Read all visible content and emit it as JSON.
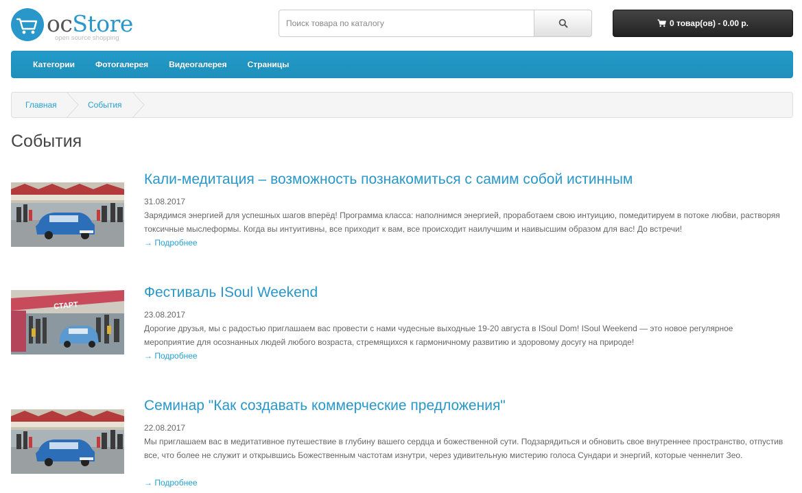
{
  "logo": {
    "oc": "oc",
    "store": "Store",
    "tagline": "open source shopping"
  },
  "search": {
    "placeholder": "Поиск товара по каталогу",
    "icon": "search-icon"
  },
  "cart": {
    "label": "0 товар(ов) - 0.00 р.",
    "icon": "cart-icon"
  },
  "menu": {
    "items": [
      {
        "label": "Категории"
      },
      {
        "label": "Фотогалерея"
      },
      {
        "label": "Видеогалерея"
      },
      {
        "label": "Страницы"
      }
    ]
  },
  "breadcrumb": {
    "items": [
      {
        "label": "Главная"
      },
      {
        "label": "События"
      }
    ]
  },
  "page_title": "События",
  "events": [
    {
      "title": "Кали-медитация – возможность познакомиться с самим собой истинным",
      "date": "31.08.2017",
      "text": "Зарядимся энергией для успешных шагов вперёд! Программа класса: наполнимся энергией, проработаем свою интуицию, помедитируем в потоке любви, растворяя токсичные мыслеформы. Когда вы интуитивны, все приходит к вам, все происходит наилучшим и наивысшим образом для вас! До встречи!",
      "more": "→ Подробнее"
    },
    {
      "title": "Фестиваль ISoul Weekend",
      "date": "23.08.2017",
      "text": "Дорогие друзья, мы с радостью приглашаем вас провести с нами чудесные выходные 19-20 августа в ISoul Dom! ISoul Weekend — это новое регулярное мероприятие для осознанных людей любого возраста, стремящихся к гармоничному развитию и здоровому досугу на природе!",
      "more": "→ Подробнее",
      "banner": "СТАРТ"
    },
    {
      "title": "Семинар \"Как создавать коммерческие предложения\"",
      "date": "22.08.2017",
      "text": "Мы приглашаем вас в медитативное путешествие в глубину вашего сердца и божественной сути. Подзарядиться и обновить свое внутреннее пространство, отпустив все, что более не служит и открывшись Божественным частотам изнутри, через удивительную мистерию голоса Сундари и энергий, которые ченнелит Зео.",
      "more": "→ Подробнее"
    }
  ],
  "colors": {
    "accent": "#2997c9",
    "menu": "#229ac8",
    "link": "#23a1d1",
    "cart": "#333333"
  }
}
